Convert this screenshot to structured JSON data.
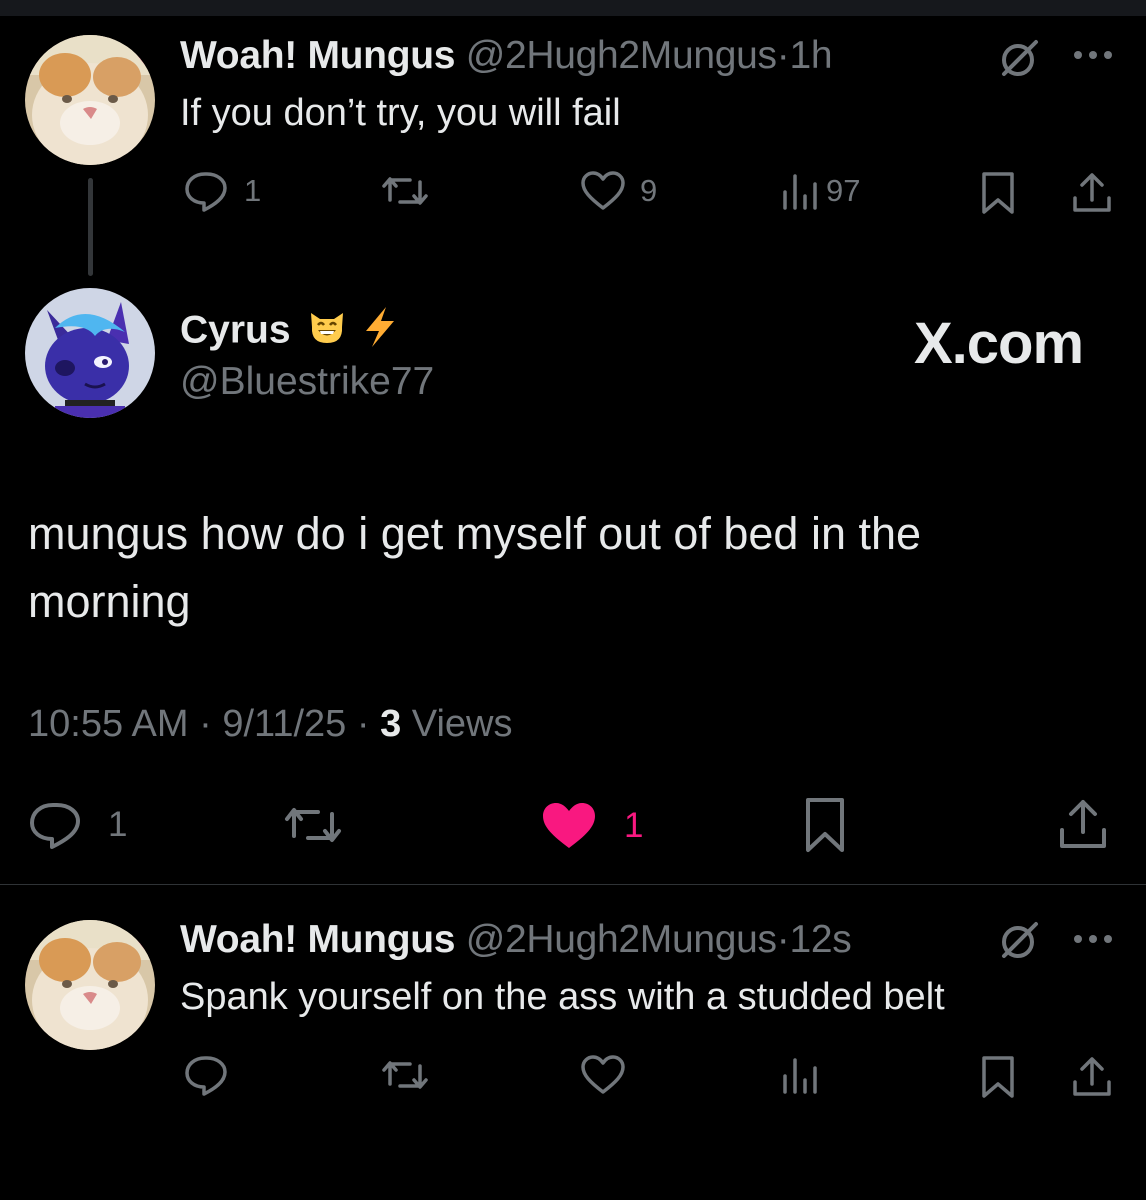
{
  "colors": {
    "background": "#000000",
    "text": "#e7e9ea",
    "muted": "#71767b",
    "like_active": "#f91880",
    "divider": "#2f3336"
  },
  "reply1": {
    "display_name": "Woah! Mungus",
    "handle": "@2Hugh2Mungus",
    "separator": "·",
    "time": "1h",
    "text": "If you don’t try, you will fail",
    "replies": "1",
    "likes": "9",
    "views": "97",
    "icons": [
      "grok-icon",
      "more-icon",
      "reply-icon",
      "retweet-icon",
      "like-icon",
      "views-icon",
      "bookmark-icon",
      "share-icon"
    ]
  },
  "main_post": {
    "display_name": "Cyrus",
    "name_emojis": [
      "smiling-cat-emoji",
      "lightning-emoji"
    ],
    "handle": "@Bluestrike77",
    "watermark": "X.com",
    "text_line1": "mungus how do i get myself out of bed in the",
    "text_line2": "morning",
    "time": "10:55 AM",
    "separator": "·",
    "date": "9/11/25",
    "views_count": "3",
    "views_label": "Views",
    "replies": "1",
    "likes": "1",
    "liked": true
  },
  "reply2": {
    "display_name": "Woah! Mungus",
    "handle": "@2Hugh2Mungus",
    "separator": "·",
    "time": "12s",
    "text": "Spank yourself on the ass with a studded belt"
  }
}
